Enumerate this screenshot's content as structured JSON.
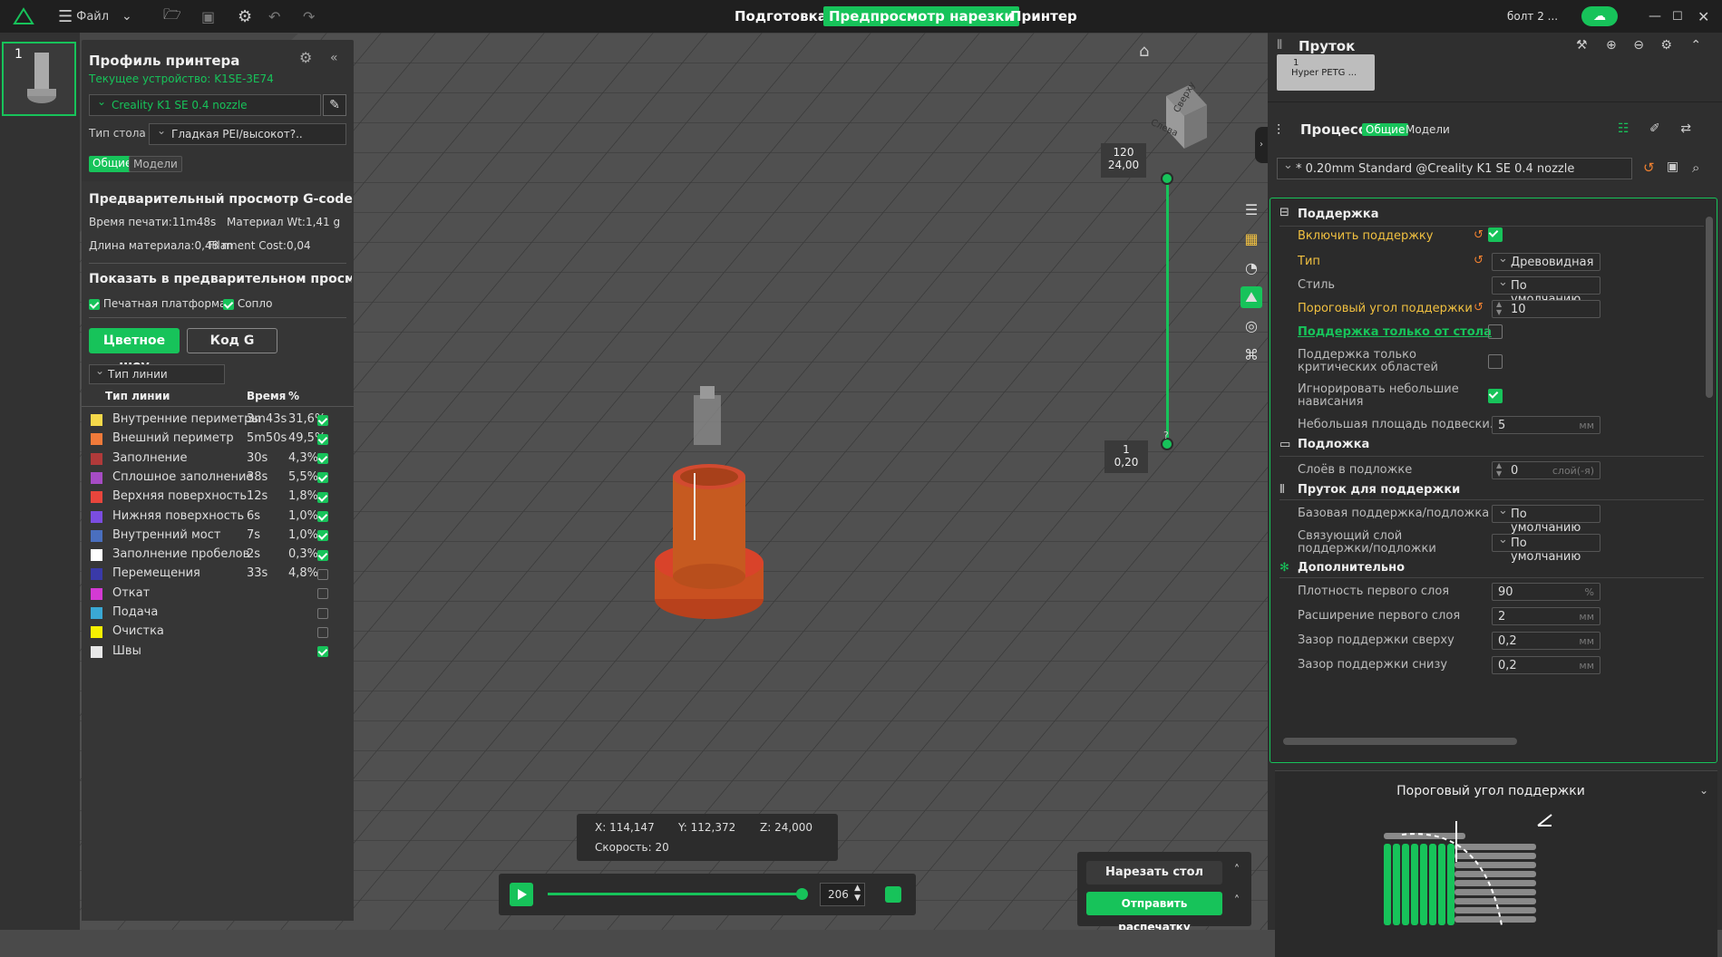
{
  "topbar": {
    "file_label": "Файл",
    "tabs": [
      "Подготовка",
      "Предпросмотр нарезки",
      "Принтер"
    ],
    "project_name": "болт 2 ..."
  },
  "thumb": {
    "index": "1"
  },
  "left": {
    "printer_profile_title": "Профиль принтера",
    "current_device": "Текущее устройство: K1SE-3E74",
    "nozzle_profile": "Creality K1 SE 0.4 nozzle",
    "bed_label": "Тип стола",
    "bed_value": "Гладкая PEI/высокот?..",
    "tab_general": "Общие",
    "tab_models": "Модели",
    "gcode_title": "Предварительный просмотр G-code",
    "print_time": "Время печати:11m48s",
    "material_wt": "Материал Wt:1,41 g",
    "filament_length": "Длина материала:0,48 m",
    "filament_cost": "Filament Cost:0,04",
    "show_title": "Показать в предварительном просмо",
    "show_platform": "Печатная платформа",
    "show_nozzle": "Сопло",
    "btn_color_show": "Цветное шоу",
    "btn_gcode": "Код G",
    "line_type_select": "Тип линии",
    "col_type": "Тип линии",
    "col_time": "Время",
    "col_pct": "%",
    "legend": [
      {
        "name": "Внутренние периметры",
        "time": "3m43s",
        "pct": "31,6%",
        "color": "#f5d94a",
        "checked": true
      },
      {
        "name": "Внешний периметр",
        "time": "5m50s",
        "pct": "49,5%",
        "color": "#f07a3a",
        "checked": true
      },
      {
        "name": "Заполнение",
        "time": "30s",
        "pct": "4,3%",
        "color": "#b03a3a",
        "checked": true
      },
      {
        "name": "Сплошное заполнение",
        "time": "38s",
        "pct": "5,5%",
        "color": "#a64cc4",
        "checked": true
      },
      {
        "name": "Верхняя поверхность",
        "time": "12s",
        "pct": "1,8%",
        "color": "#e8453c",
        "checked": true
      },
      {
        "name": "Нижняя поверхность",
        "time": "6s",
        "pct": "1,0%",
        "color": "#7b4de0",
        "checked": true
      },
      {
        "name": "Внутренний мост",
        "time": "7s",
        "pct": "1,0%",
        "color": "#4a6fbf",
        "checked": true
      },
      {
        "name": "Заполнение пробелов",
        "time": "2s",
        "pct": "0,3%",
        "color": "#ffffff",
        "checked": true
      },
      {
        "name": "Перемещения",
        "time": "33s",
        "pct": "4,8%",
        "color": "#3a3aa8",
        "checked": false
      },
      {
        "name": "Откат",
        "time": "",
        "pct": "",
        "color": "#d43ad4",
        "checked": false
      },
      {
        "name": "Подача",
        "time": "",
        "pct": "",
        "color": "#3aa8d4",
        "checked": false
      },
      {
        "name": "Очистка",
        "time": "",
        "pct": "",
        "color": "#f5f000",
        "checked": false
      },
      {
        "name": "Швы",
        "time": "",
        "pct": "",
        "color": "#e8e8e8",
        "checked": true
      }
    ]
  },
  "viewport": {
    "cube_top": "Сверху",
    "cube_left": "Слева",
    "layer_top_num": "120",
    "layer_top_h": "24,00",
    "layer_bot_num": "1",
    "layer_bot_h": "0,20",
    "help": "?",
    "coord_x": "X: 114,147",
    "coord_y": "Y: 112,372",
    "coord_z": "Z: 24,000",
    "speed": "Скорость: 20",
    "layer_value": "206",
    "btn_slice_plate": "Нарезать стол",
    "btn_send_print": "Отправить распечатку"
  },
  "right": {
    "filament_title": "Пруток",
    "filament_slot_num": "1",
    "filament_slot_name": "Hyper PETG ...",
    "process_title": "Процесс",
    "tab_general": "Общие",
    "tab_models": "Модели",
    "process_profile": "* 0.20mm  Standard @Creality K1 SE 0.4 nozzle",
    "sec_support": "Поддержка",
    "enable_support": "Включить поддержку",
    "type_label": "Тип",
    "type_value": "Древовидная ...",
    "style_label": "Стиль",
    "style_value": "По умолчанию",
    "threshold_label": "Пороговый угол поддержки",
    "threshold_value": "10",
    "only_bed_label": "Поддержка только от стола",
    "critical_label_1": "Поддержка только",
    "critical_label_2": "критических областей",
    "ignore_small_1": "Игнорировать небольшие",
    "ignore_small_2": "нависания",
    "small_area_label": "Небольшая площадь подвески.",
    "small_area_value": "5",
    "unit_mm": "мм",
    "sec_raft": "Подложка",
    "raft_layers_label": "Слоёв в подложке",
    "raft_layers_value": "0",
    "raft_layers_unit": "слой(-я)",
    "sec_support_fil": "Пруток для поддержки",
    "base_support_label": "Базовая поддержка/подложка",
    "base_support_value": "По умолчанию",
    "interface_label_1": "Связующий слой",
    "interface_label_2": "поддержки/подложки",
    "interface_value": "По умолчанию",
    "sec_advanced": "Дополнительно",
    "first_density_label": "Плотность первого слоя",
    "first_density_value": "90",
    "unit_pct": "%",
    "first_expand_label": "Расширение первого слоя",
    "first_expand_value": "2",
    "top_gap_label": "Зазор поддержки сверху",
    "top_gap_value": "0,2",
    "bottom_gap_label": "Зазор поддержки снизу",
    "bottom_gap_value": "0,2",
    "help_title": "Пороговый угол поддержки"
  }
}
